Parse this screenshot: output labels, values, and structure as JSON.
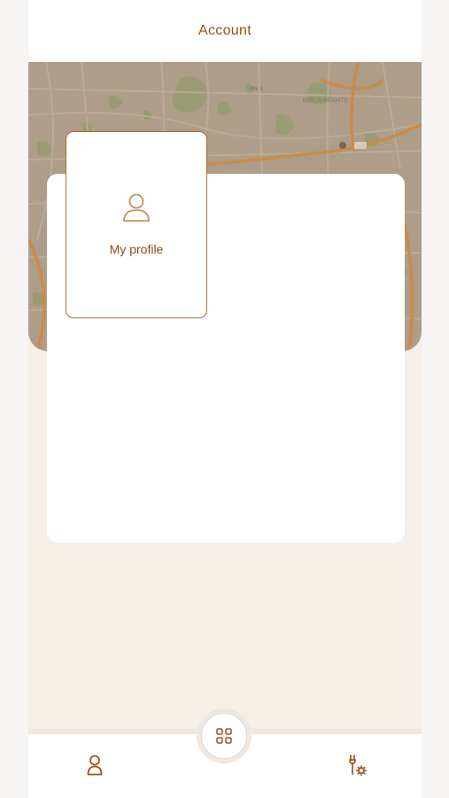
{
  "header": {
    "title": "Account"
  },
  "map": {
    "tile_labels": [
      "BERLIN HEIGHTS",
      "166",
      "SW 3"
    ]
  },
  "tiles": [
    {
      "label": "My profile",
      "icon": "user-icon"
    }
  ],
  "bottom_nav": {
    "left_icon": "person-icon",
    "center_icon": "grid-icon",
    "right_icon": "wrench-gear-icon"
  },
  "colors": {
    "accent": "#9a4d0f",
    "tile_border": "#b06a2a",
    "background": "#f5efe8",
    "map_overlay": "#b6a794"
  }
}
